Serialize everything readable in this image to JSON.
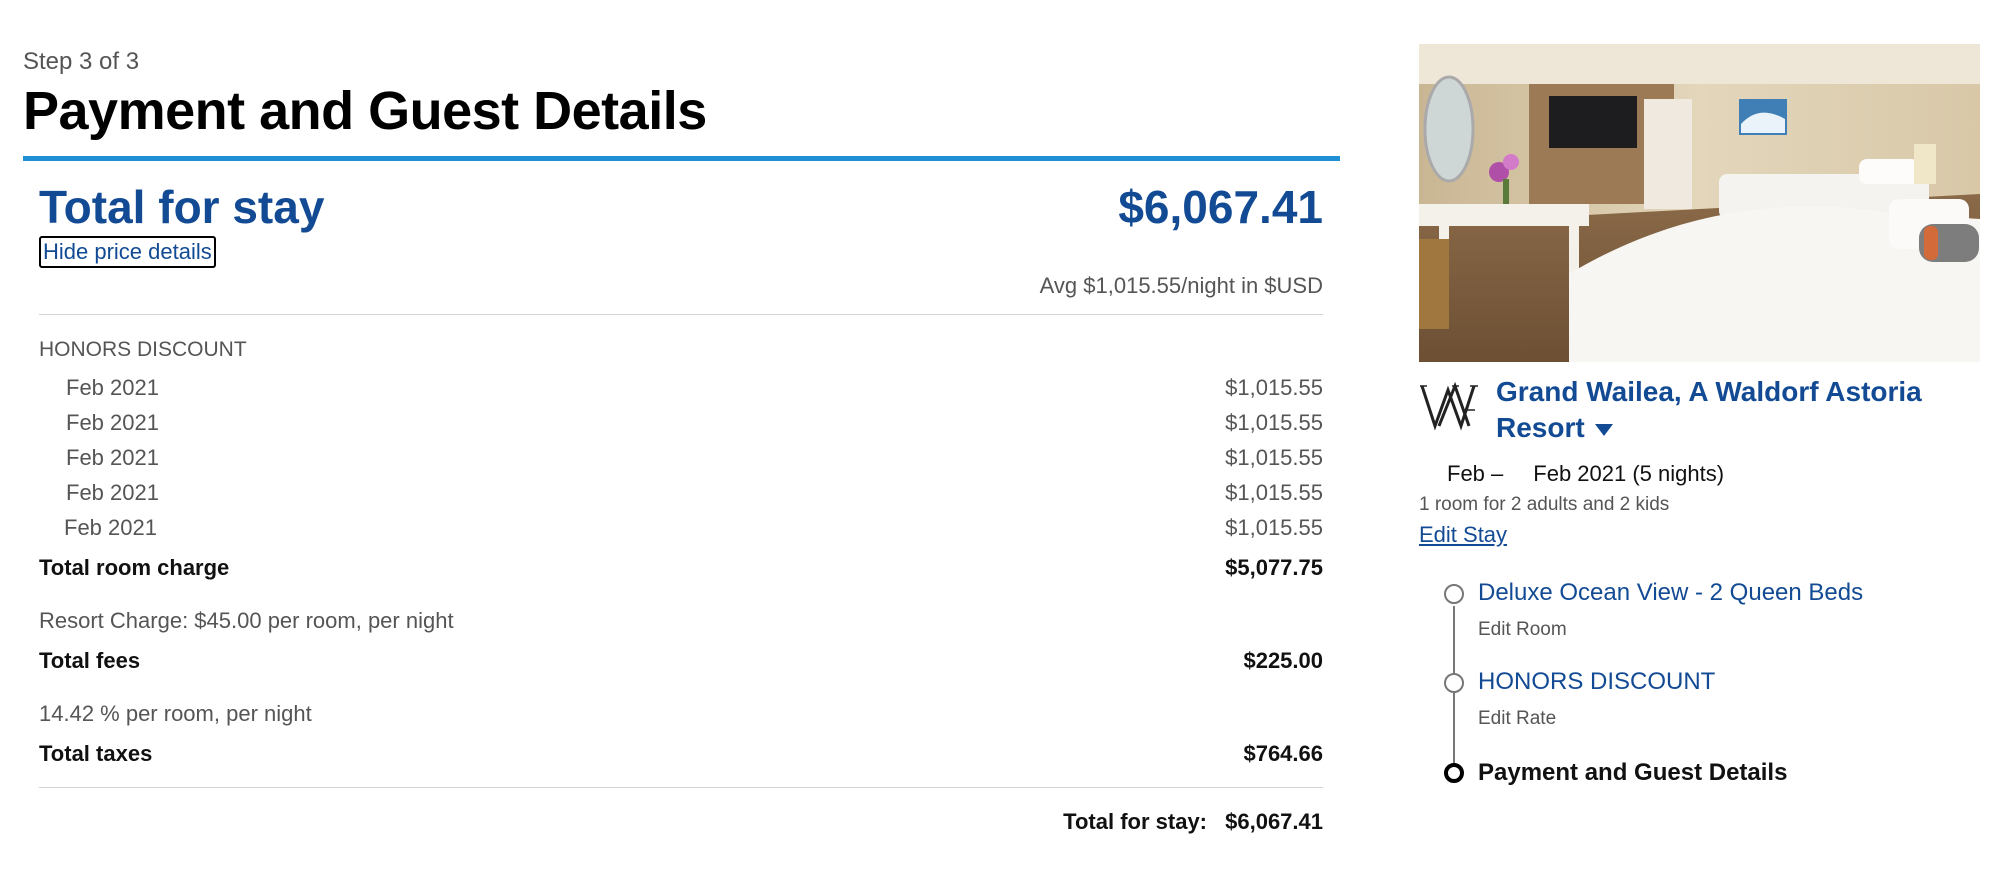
{
  "header": {
    "step": "Step 3 of 3",
    "title": "Payment and Guest Details"
  },
  "price": {
    "total_label": "Total for stay",
    "total_amount": "$6,067.41",
    "hide_details": "Hide price details",
    "avg_night": "Avg $1,015.55/night in $USD",
    "rate_name": "HONORS DISCOUNT",
    "nights": [
      {
        "date": "Feb 2021",
        "price": "$1,015.55"
      },
      {
        "date": "Feb 2021",
        "price": "$1,015.55"
      },
      {
        "date": "Feb 2021",
        "price": "$1,015.55"
      },
      {
        "date": "Feb 2021",
        "price": "$1,015.55"
      },
      {
        "date": "Feb 2021",
        "price": "$1,015.55"
      }
    ],
    "room_charge_label": "Total room charge",
    "room_charge_value": "$5,077.75",
    "resort_charge_note": "Resort Charge: $45.00 per room, per night",
    "fees_label": "Total fees",
    "fees_value": "$225.00",
    "tax_note": "14.42 % per room, per night",
    "taxes_label": "Total taxes",
    "taxes_value": "$764.66",
    "grand_label": "Total for stay:",
    "grand_value": "$6,067.41"
  },
  "summary": {
    "hotel_name": "Grand Wailea, A Waldorf Astoria Resort",
    "dates_start": "Feb –",
    "dates_end": "Feb 2021 (5 nights)",
    "guests": "1 room for 2 adults and 2 kids",
    "edit_stay": "Edit Stay",
    "room_title": "Deluxe Ocean View - 2 Queen Beds",
    "room_edit": "Edit Room",
    "rate_title": "HONORS DISCOUNT",
    "rate_edit": "Edit Rate",
    "current_step": "Payment and Guest Details"
  },
  "colors": {
    "brand_blue": "#124a94",
    "accent_rule": "#1f8fd6"
  }
}
